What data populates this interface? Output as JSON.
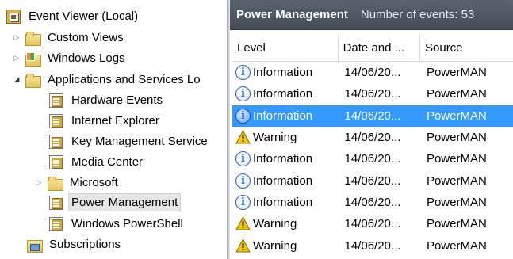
{
  "tree": {
    "root": "Event Viewer (Local)",
    "custom_views": "Custom Views",
    "windows_logs": "Windows Logs",
    "apps_services": "Applications and Services Lo",
    "hardware_events": "Hardware Events",
    "internet_explorer": "Internet Explorer",
    "key_management": "Key Management Service",
    "media_center": "Media Center",
    "microsoft": "Microsoft",
    "power_management": "Power Management",
    "windows_powershell": "Windows PowerShell",
    "subscriptions": "Subscriptions"
  },
  "panel": {
    "title": "Power Management",
    "count": "Number of events: 53"
  },
  "grid": {
    "columns": [
      "Level",
      "Date and ...",
      "Source"
    ],
    "rows": [
      {
        "level": "Information",
        "date": "14/06/20...",
        "source": "PowerMAN",
        "icon": "information-icon"
      },
      {
        "level": "Information",
        "date": "14/06/20...",
        "source": "PowerMAN",
        "icon": "information-icon"
      },
      {
        "level": "Information",
        "date": "14/06/20...",
        "source": "PowerMAN",
        "icon": "information-icon",
        "selected": true
      },
      {
        "level": "Warning",
        "date": "14/06/20...",
        "source": "PowerMAN",
        "icon": "warning-icon"
      },
      {
        "level": "Information",
        "date": "14/06/20...",
        "source": "PowerMAN",
        "icon": "information-icon"
      },
      {
        "level": "Information",
        "date": "14/06/20...",
        "source": "PowerMAN",
        "icon": "information-icon"
      },
      {
        "level": "Information",
        "date": "14/06/20...",
        "source": "PowerMAN",
        "icon": "information-icon"
      },
      {
        "level": "Warning",
        "date": "14/06/20...",
        "source": "PowerMAN",
        "icon": "warning-icon"
      },
      {
        "level": "Warning",
        "date": "14/06/20...",
        "source": "PowerMAN",
        "icon": "warning-icon"
      }
    ]
  },
  "colors": {
    "panel_header": "#4f5763",
    "selection": "#3399ff",
    "info_blue": "#2b5fb8",
    "warning_yellow": "#f5c400"
  }
}
